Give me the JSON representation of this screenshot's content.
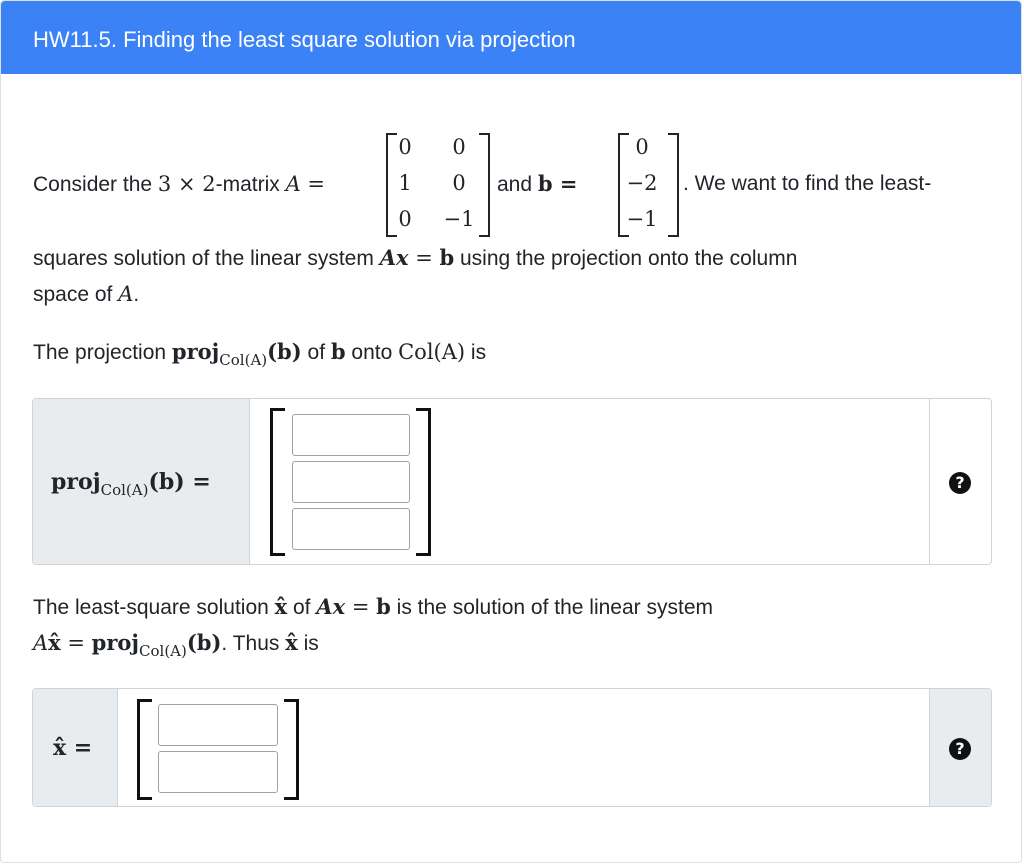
{
  "header": {
    "title": "HW11.5. Finding the least square solution via projection"
  },
  "intro": {
    "p1_before": "Consider the ",
    "dims": "3 × 2",
    "p1_mid": "-matrix ",
    "A_eq": "A =",
    "and_text": " and ",
    "b_eq": "b =",
    "p1_after": ". We want to find the least-",
    "p2_before": "squares solution of the linear system ",
    "Ax": "Ax",
    "eq": " = ",
    "b": "b",
    "p2_after": " using the projection onto the column",
    "p3_before": "space of ",
    "A": "A",
    "p3_after": ".",
    "matrix_A": [
      [
        "0",
        "0"
      ],
      [
        "1",
        "0"
      ],
      [
        "0",
        "−1"
      ]
    ],
    "vector_b": [
      "0",
      "−2",
      "−1"
    ]
  },
  "projection_text": {
    "before": "The projection ",
    "proj": "proj",
    "col_sub": "Col(A)",
    "arg": "(b)",
    "mid": " of ",
    "b": "b",
    "onto": " onto ",
    "col": "Col(A)",
    "after": " is"
  },
  "projection_input": {
    "label_proj": "proj",
    "label_sub": "Col(A)",
    "label_arg": "(b) =",
    "cells": [
      "",
      "",
      ""
    ],
    "help": "?"
  },
  "solution_text": {
    "l1_before": "The least-square solution ",
    "xhat": "x̂",
    "of": " of ",
    "Ax": "Ax",
    "eq": " = ",
    "b": "b",
    "l1_after": " is the solution of the linear system",
    "l2_A": "A",
    "l2_xhat": "x̂",
    "l2_eq": " = ",
    "l2_proj": "proj",
    "l2_sub": "Col(A)",
    "l2_arg": "(b)",
    "l2_after": ". Thus ",
    "l2_xhat2": "x̂",
    "l2_is": " is"
  },
  "solution_input": {
    "label": "x̂ =",
    "cells": [
      "",
      ""
    ],
    "help": "?"
  }
}
